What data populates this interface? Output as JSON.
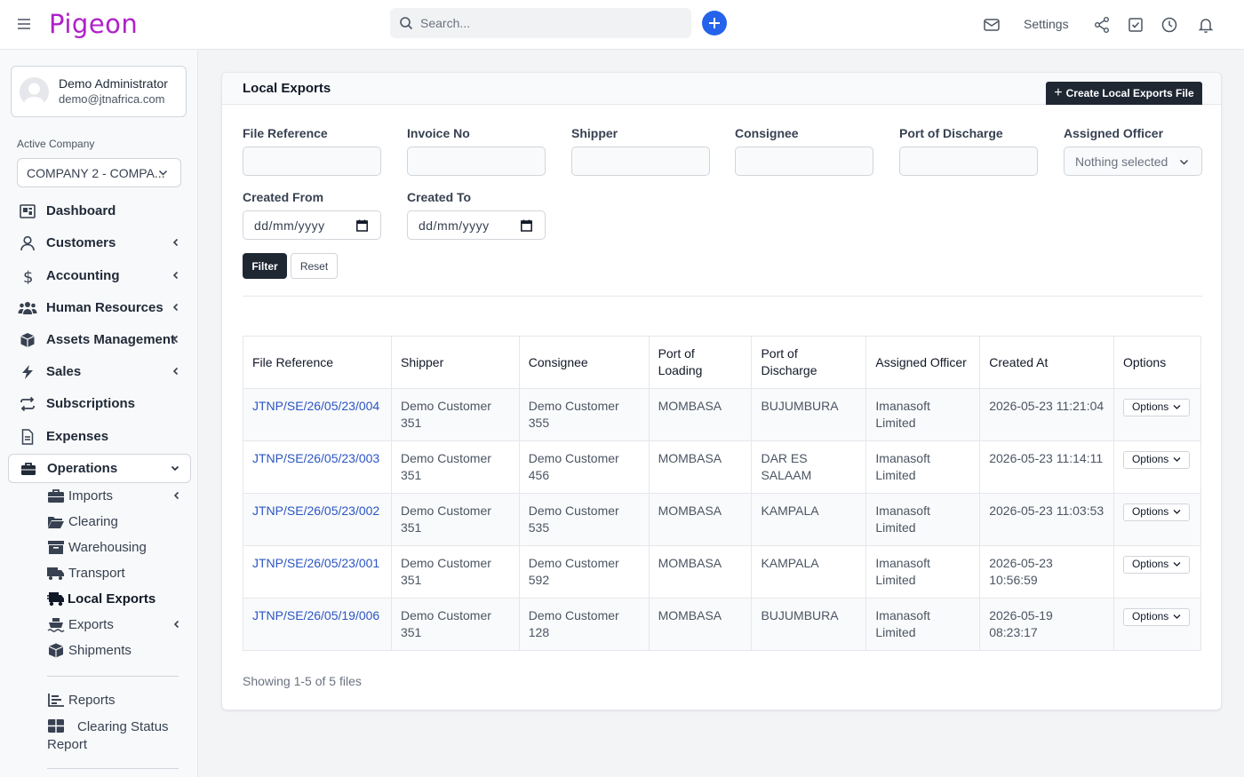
{
  "app": {
    "brand": "Pigeon"
  },
  "topbar": {
    "search_placeholder": "Search...",
    "settings_label": "Settings"
  },
  "profile": {
    "name": "Demo Administrator",
    "email": "demo@jtnafrica.com"
  },
  "company": {
    "label": "Active Company",
    "selected": "COMPANY 2 - COMPA..."
  },
  "nav": {
    "dashboard": "Dashboard",
    "customers": "Customers",
    "accounting": "Accounting",
    "human_resources": "Human Resources",
    "assets": "Assets Management",
    "sales": "Sales",
    "subscriptions": "Subscriptions",
    "expenses": "Expenses",
    "operations": "Operations",
    "sub": {
      "imports": "Imports",
      "clearing": "Clearing",
      "warehousing": "Warehousing",
      "transport": "Transport",
      "local_exports": "Local Exports",
      "exports": "Exports",
      "shipments": "Shipments",
      "reports": "Reports",
      "clearing_status_report": "Clearing Status Report"
    }
  },
  "page": {
    "title": "Local Exports",
    "create_button": "Create Local Exports File"
  },
  "filters": {
    "file_reference": {
      "label": "File Reference",
      "value": ""
    },
    "invoice_no": {
      "label": "Invoice No",
      "value": ""
    },
    "shipper": {
      "label": "Shipper",
      "value": ""
    },
    "consignee": {
      "label": "Consignee",
      "value": ""
    },
    "port_of_discharge": {
      "label": "Port of Discharge",
      "value": ""
    },
    "assigned_officer": {
      "label": "Assigned Officer",
      "placeholder": "Nothing selected"
    },
    "created_from": {
      "label": "Created From",
      "placeholder": "dd/mm/yyyy"
    },
    "created_to": {
      "label": "Created To",
      "placeholder": "dd/mm/yyyy"
    },
    "filter_button": "Filter",
    "reset_button": "Reset"
  },
  "table": {
    "headers": [
      "File Reference",
      "Shipper",
      "Consignee",
      "Port of Loading",
      "Port of Discharge",
      "Assigned Officer",
      "Created At",
      "Options"
    ],
    "rows": [
      {
        "ref": "JTNP/SE/26/05/23/004",
        "shipper": "Demo Customer 351",
        "consignee": "Demo Customer 355",
        "pol": "MOMBASA",
        "pod": "BUJUMBURA",
        "officer": "Imanasoft Limited",
        "created": "2026-05-23 11:21:04",
        "options": "Options"
      },
      {
        "ref": "JTNP/SE/26/05/23/003",
        "shipper": "Demo Customer 351",
        "consignee": "Demo Customer 456",
        "pol": "MOMBASA",
        "pod": "DAR ES SALAAM",
        "officer": "Imanasoft Limited",
        "created": "2026-05-23 11:14:11",
        "options": "Options"
      },
      {
        "ref": "JTNP/SE/26/05/23/002",
        "shipper": "Demo Customer 351",
        "consignee": "Demo Customer 535",
        "pol": "MOMBASA",
        "pod": "KAMPALA",
        "officer": "Imanasoft Limited",
        "created": "2026-05-23 11:03:53",
        "options": "Options"
      },
      {
        "ref": "JTNP/SE/26/05/23/001",
        "shipper": "Demo Customer 351",
        "consignee": "Demo Customer 592",
        "pol": "MOMBASA",
        "pod": "KAMPALA",
        "officer": "Imanasoft Limited",
        "created": "2026-05-23 10:56:59",
        "options": "Options"
      },
      {
        "ref": "JTNP/SE/26/05/19/006",
        "shipper": "Demo Customer 351",
        "consignee": "Demo Customer 128",
        "pol": "MOMBASA",
        "pod": "BUJUMBURA",
        "officer": "Imanasoft Limited",
        "created": "2026-05-19 08:23:17",
        "options": "Options"
      }
    ],
    "footer": "Showing 1-5 of 5 files"
  },
  "colors": {
    "brand": "#b021c9",
    "accent": "#2563eb",
    "dark_button": "#1f2733",
    "link": "#2b55c4"
  }
}
